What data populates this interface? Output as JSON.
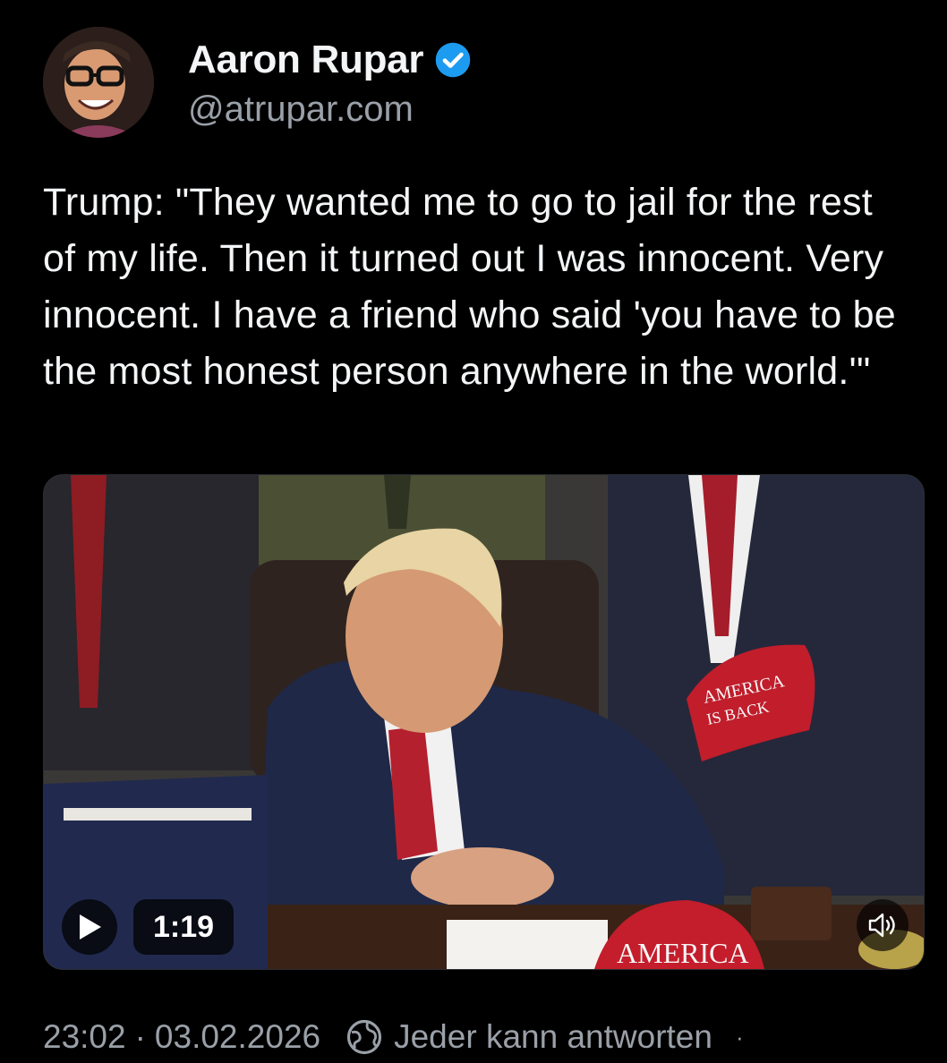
{
  "author": {
    "display_name": "Aaron Rupar",
    "handle": "@atrupar.com",
    "verified": true,
    "avatar_icon": "user-avatar",
    "verified_color": "#1d9bf0"
  },
  "post": {
    "text": "Trump: \"They wanted me to go to jail for the rest of my life. Then it turned out I was innocent. Very innocent. I have a friend who said 'you have to be the most honest person anywhere in the world.'\""
  },
  "media": {
    "type": "video",
    "duration": "1:19",
    "play_icon": "play-icon",
    "sound_icon": "speaker-icon",
    "cap_text_top": "AMERICA",
    "cap_text_bottom": "IS BACK",
    "cap_text_desk": "AMERICA"
  },
  "meta": {
    "time": "23:02",
    "separator": "·",
    "date": "03.02.2026",
    "reply_setting": "Jeder kann antworten",
    "reply_icon": "globe-icon",
    "trailing": "·"
  }
}
